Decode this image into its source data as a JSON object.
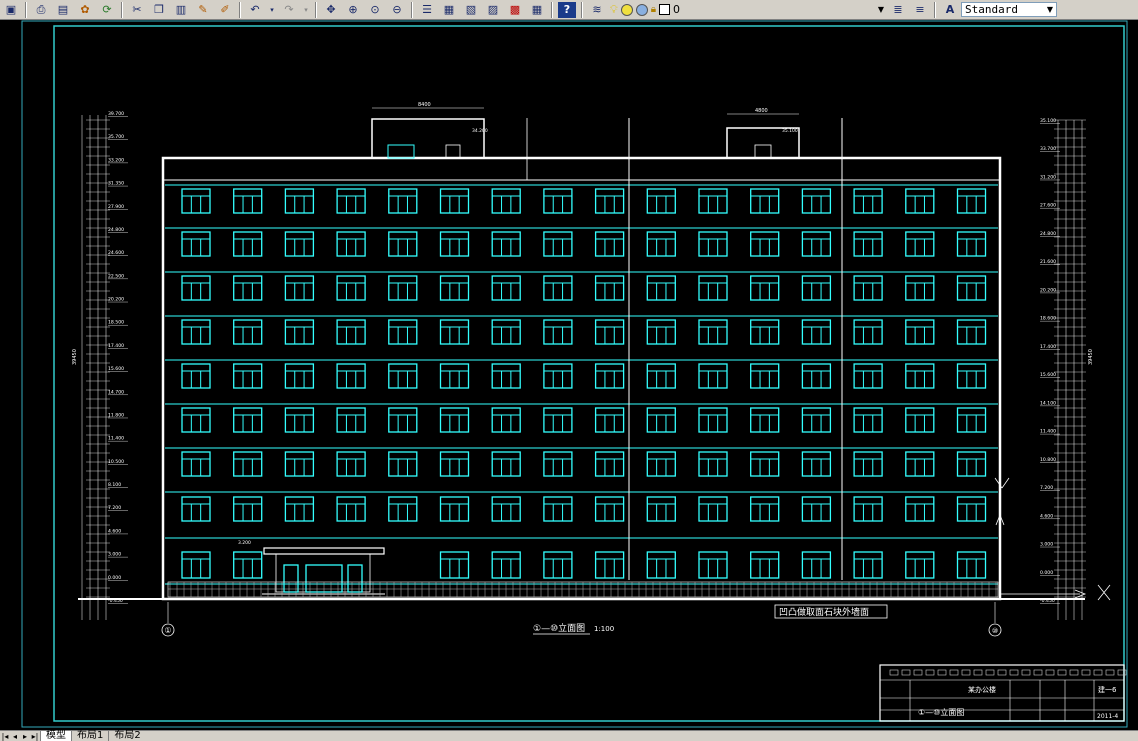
{
  "toolbar": {
    "layer_name": "0",
    "text_style": "Standard"
  },
  "drawing": {
    "left_elevations": [
      "39.700",
      "35.700",
      "33.200",
      "31.350",
      "27.900",
      "24.800",
      "24.600",
      "22.500",
      "20.200",
      "18.500",
      "17.400",
      "15.600",
      "14.700",
      "11.800",
      "11.400",
      "10.500",
      "8.100",
      "7.200",
      "4.600",
      "3.000",
      "0.000",
      "-0.450"
    ],
    "right_elevations": [
      "35.100",
      "33.700",
      "31.200",
      "27.600",
      "24.800",
      "21.600",
      "20.200",
      "18.600",
      "17.400",
      "15.600",
      "14.100",
      "11.400",
      "10.800",
      "7.200",
      "4.600",
      "3.000",
      "0.000",
      "-0.450"
    ],
    "overall_left": "39450",
    "overall_right": "39450",
    "roof_left_width": "8400",
    "roof_right_width": "4800",
    "roof_elev_1": "34.200",
    "roof_elev_2": "35.100",
    "canopy_elev": "3.200",
    "elevation_title": "①—⑩立面图",
    "elevation_scale": "1:100",
    "axis_left": "①",
    "axis_right": "⑩",
    "note_label": "凹凸做取面石块外墙面",
    "titleblock": {
      "project": "某办公楼",
      "drawing": "①—⑩立面图",
      "sheet": "建一6",
      "date": "2011-4"
    }
  },
  "tabs": [
    {
      "label": "模型",
      "active": true
    },
    {
      "label": "布局1",
      "active": false
    },
    {
      "label": "布局2",
      "active": false
    }
  ]
}
